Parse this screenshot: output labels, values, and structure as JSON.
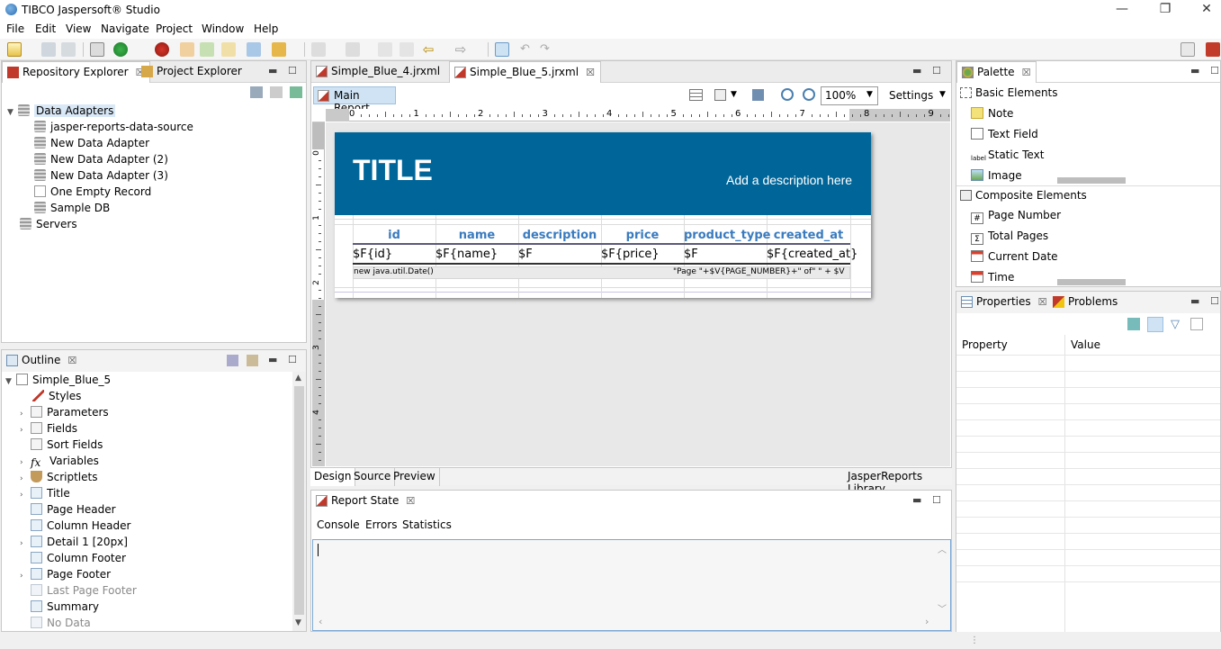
{
  "window": {
    "title": "TIBCO Jaspersoft® Studio",
    "minimize": "—",
    "restore": "❐",
    "close": "✕"
  },
  "menu": [
    "File",
    "Edit",
    "View",
    "Navigate",
    "Project",
    "Window",
    "Help"
  ],
  "repo": {
    "tabs": [
      {
        "label": "Repository Explorer",
        "close": "☒"
      },
      {
        "label": "Project Explorer"
      }
    ],
    "items": [
      {
        "label": "Data Adapters"
      },
      {
        "label": "jasper-reports-data-source"
      },
      {
        "label": "New Data Adapter"
      },
      {
        "label": "New Data Adapter (2)"
      },
      {
        "label": "New Data Adapter (3)"
      },
      {
        "label": "One Empty Record"
      },
      {
        "label": "Sample DB"
      },
      {
        "label": "Servers"
      }
    ]
  },
  "outline": {
    "tab": "Outline",
    "items": [
      {
        "label": "Simple_Blue_5"
      },
      {
        "label": "Styles"
      },
      {
        "label": "Parameters"
      },
      {
        "label": "Fields"
      },
      {
        "label": "Sort Fields"
      },
      {
        "label": "Variables"
      },
      {
        "label": "Scriptlets"
      },
      {
        "label": "Title"
      },
      {
        "label": "Page Header"
      },
      {
        "label": "Column Header"
      },
      {
        "label": "Detail 1 [20px]"
      },
      {
        "label": "Column Footer"
      },
      {
        "label": "Page Footer"
      },
      {
        "label": "Last Page Footer"
      },
      {
        "label": "Summary"
      },
      {
        "label": "No Data"
      }
    ]
  },
  "editor": {
    "tabs": [
      "Simple_Blue_4.jrxml",
      "Simple_Blue_5.jrxml"
    ],
    "main_report": "Main Report",
    "zoom": "100%",
    "settings": "Settings",
    "ruler": [
      "0",
      "1",
      "2",
      "3",
      "4",
      "5",
      "6",
      "7",
      "8",
      "9"
    ],
    "vruler": [
      "0",
      "1",
      "2",
      "3",
      "4"
    ],
    "bottom_tabs": [
      "Design",
      "Source",
      "Preview"
    ],
    "library": "JasperReports Library"
  },
  "report": {
    "title": "TITLE",
    "description": "Add a description here",
    "headers": [
      "id",
      "name",
      "description",
      "price",
      "product_type",
      "created_at"
    ],
    "fields": [
      "$F{id}",
      "$F{name}",
      "$F",
      "$F{price}",
      "$F",
      "$F{created_at}"
    ],
    "footer_left": "new java.util.Date()",
    "footer_right": "\"Page \"+$V{PAGE_NUMBER}+\" of\" \" + $V"
  },
  "report_state": {
    "tab": "Report State",
    "subtabs": [
      "Console",
      "Errors",
      "Statistics"
    ]
  },
  "palette": {
    "tab": "Palette",
    "basic": "Basic Elements",
    "basic_items": [
      "Note",
      "Text Field",
      "Static Text",
      "Image"
    ],
    "composite": "Composite Elements",
    "composite_items": [
      "Page Number",
      "Total Pages",
      "Current Date",
      "Time"
    ]
  },
  "properties": {
    "tab": "Properties",
    "tab2": "Problems",
    "col1": "Property",
    "col2": "Value"
  }
}
